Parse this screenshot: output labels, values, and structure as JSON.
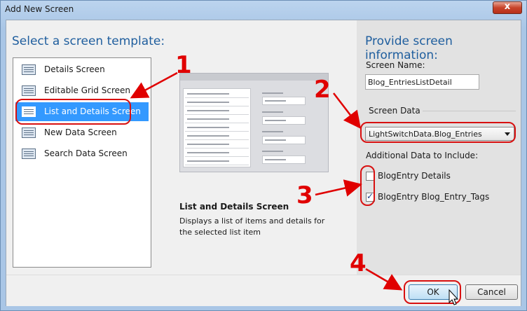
{
  "window": {
    "title": "Add New Screen",
    "close_glyph": "x"
  },
  "left": {
    "heading": "Select a screen template:",
    "templates": [
      {
        "label": "Details Screen",
        "icon": "details-screen-icon",
        "selected": false
      },
      {
        "label": "Editable Grid Screen",
        "icon": "grid-screen-icon",
        "selected": false
      },
      {
        "label": "List and Details Screen",
        "icon": "list-details-screen-icon",
        "selected": true
      },
      {
        "label": "New Data Screen",
        "icon": "new-data-screen-icon",
        "selected": false
      },
      {
        "label": "Search Data Screen",
        "icon": "search-screen-icon",
        "selected": false
      }
    ],
    "description_title": "List and Details Screen",
    "description": "Displays a list of items and details for the selected list item"
  },
  "right": {
    "heading": "Provide screen information:",
    "screen_name_label": "Screen Name:",
    "screen_name_value": "Blog_EntriesListDetail",
    "screen_data_label": "Screen Data",
    "screen_data_value": "LightSwitchData.Blog_Entries",
    "additional_label": "Additional Data to Include:",
    "additional_items": [
      {
        "label": "BlogEntry Details",
        "checked": false
      },
      {
        "label": "BlogEntry Blog_Entry_Tags",
        "checked": true
      }
    ]
  },
  "buttons": {
    "ok": "OK",
    "cancel": "Cancel"
  },
  "annotations": {
    "step1": "1",
    "step2": "2",
    "step3": "3",
    "step4": "4"
  },
  "colors": {
    "accent": "#1f5e9e",
    "selection": "#3399ff",
    "annotation": "#e00000"
  }
}
